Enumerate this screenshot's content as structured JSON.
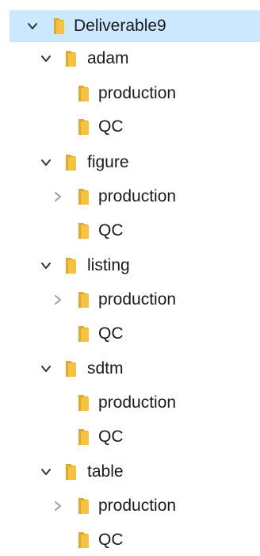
{
  "tree": [
    {
      "label": "Deliverable9",
      "depth": 0,
      "state": "expanded",
      "selected": true
    },
    {
      "label": "adam",
      "depth": 1,
      "state": "expanded"
    },
    {
      "label": "production",
      "depth": 2,
      "state": "none"
    },
    {
      "label": "QC",
      "depth": 2,
      "state": "none"
    },
    {
      "label": "figure",
      "depth": 1,
      "state": "expanded"
    },
    {
      "label": "production",
      "depth": 2,
      "state": "collapsed"
    },
    {
      "label": "QC",
      "depth": 2,
      "state": "none"
    },
    {
      "label": "listing",
      "depth": 1,
      "state": "expanded"
    },
    {
      "label": "production",
      "depth": 2,
      "state": "collapsed"
    },
    {
      "label": "QC",
      "depth": 2,
      "state": "none"
    },
    {
      "label": "sdtm",
      "depth": 1,
      "state": "expanded"
    },
    {
      "label": "production",
      "depth": 2,
      "state": "none"
    },
    {
      "label": "QC",
      "depth": 2,
      "state": "none"
    },
    {
      "label": "table",
      "depth": 1,
      "state": "expanded"
    },
    {
      "label": "production",
      "depth": 2,
      "state": "collapsed"
    },
    {
      "label": "QC",
      "depth": 2,
      "state": "none"
    }
  ],
  "icons": {
    "folder": "folder-icon",
    "expanded": "chevron-down-icon",
    "collapsed": "chevron-right-icon"
  },
  "colors": {
    "selection": "#cce8ff",
    "folder": "#f5c242",
    "folder_shadow": "#dca82e",
    "chevron": "#333333",
    "chevron_collapsed": "#a0a0a0"
  }
}
